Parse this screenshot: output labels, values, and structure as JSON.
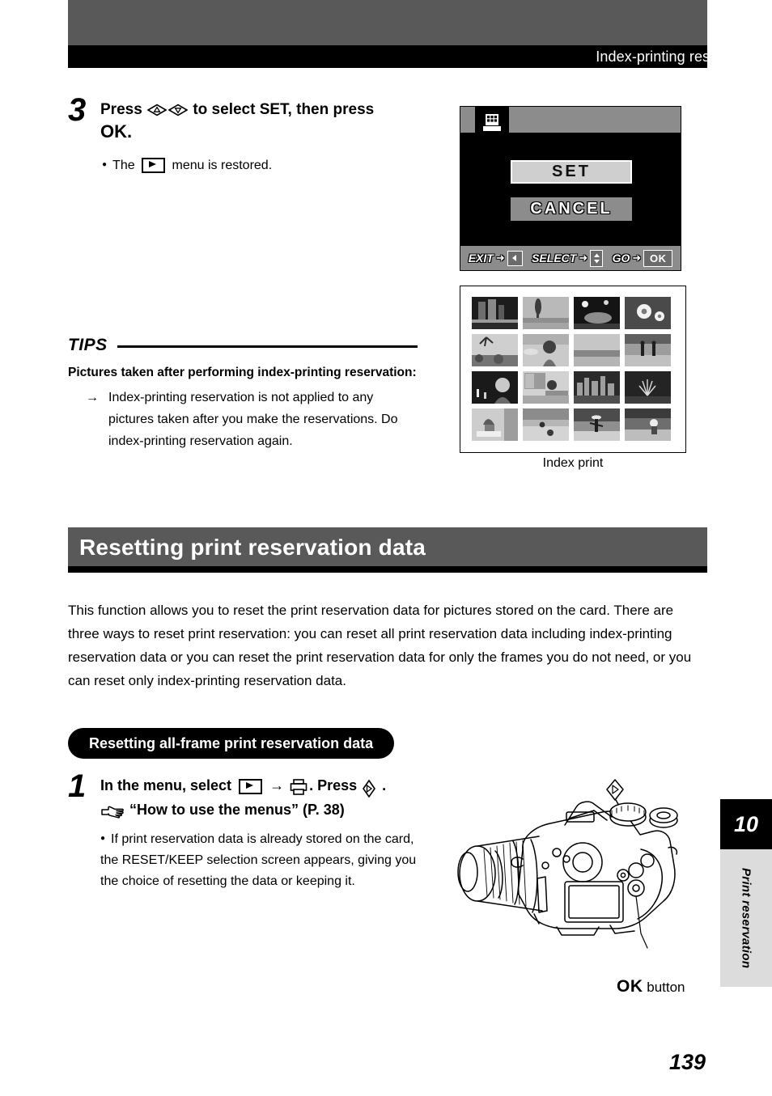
{
  "header": {
    "title": "Index-printing reservation"
  },
  "step3": {
    "number": "3",
    "head_before": "Press",
    "head_mid": "to select SET, then press",
    "head_ok": "OK.",
    "bullet_before": "The",
    "bullet_after": "menu is restored.",
    "icon_up": "arrow-pad-up-icon",
    "icon_down": "arrow-pad-down-icon",
    "icon_play": "playback-menu-icon"
  },
  "lcd": {
    "tab_icon": "index-print-icon",
    "set_label": "SET",
    "cancel_label": "CANCEL",
    "status": [
      {
        "label": "EXIT",
        "arrow": "➜",
        "key": "◀",
        "key_type": "left"
      },
      {
        "label": "SELECT",
        "arrow": "➜",
        "key": "",
        "key_type": "updown"
      },
      {
        "label": "GO",
        "arrow": "➜",
        "key": "OK",
        "key_type": "ok"
      }
    ]
  },
  "index_figure": {
    "caption": "Index print",
    "rows": 4,
    "cols": 4
  },
  "tips": {
    "word": "TIPS",
    "subhead": "Pictures taken after performing index-printing reservation:",
    "arrow": "→",
    "item": "Index-printing reservation is not applied to any pictures taken after you make the reservations. Do index-printing reservation again."
  },
  "section": {
    "title": "Resetting print reservation data",
    "intro": "This function allows you to reset the print reservation data for pictures stored on the card. There are three ways to reset print reservation: you can reset all print reservation data including index-printing reservation data or you can reset the print reservation data for only the frames you do not need, or you can reset only index-printing reservation data."
  },
  "subsection": {
    "pill_title": "Resetting all-frame print reservation data"
  },
  "step1": {
    "number": "1",
    "head_before": "In the menu, select",
    "head_arrow": "→",
    "head_after": ". Press",
    "head_end": ".",
    "ref_text": "“How to use the menus” (P. 38)",
    "bullet": "If print reservation data is already stored on the card, the RESET/KEEP selection screen appears, giving you the choice of resetting the data or keeping it.",
    "icon_play": "playback-menu-icon",
    "icon_printer": "printer-icon",
    "icon_pad_right": "arrow-pad-right-icon",
    "icon_hand": "pointing-hand-icon"
  },
  "camera": {
    "ok_button_bold": "OK",
    "ok_button_rest": "button",
    "callout_pad_icon": "arrow-pad-right-icon"
  },
  "side_tab": {
    "chapter_number": "10",
    "chapter_name": "Print reservation"
  },
  "page_number": "139",
  "colors": {
    "header_gray": "#595959",
    "header_black": "#000000",
    "lcd_gray": "#8c8c8c",
    "lcd_black": "#000000",
    "tab_gray": "#dcdcdc"
  }
}
